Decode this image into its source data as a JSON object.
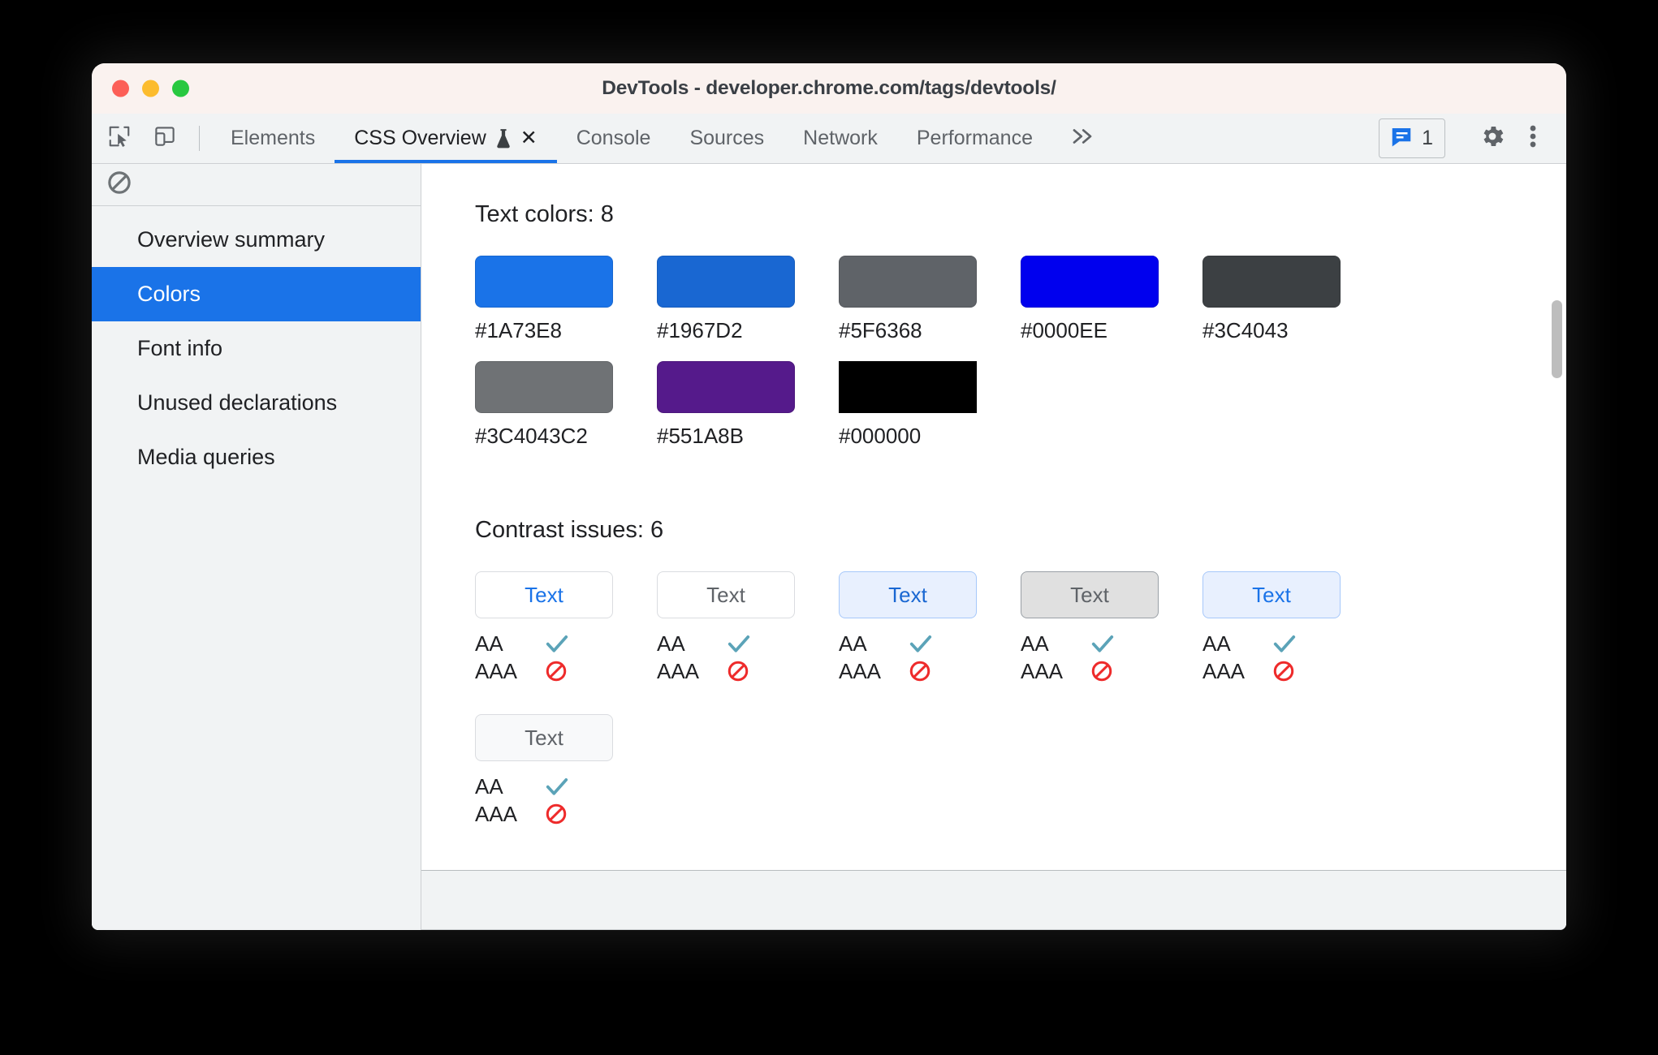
{
  "window": {
    "title": "DevTools - developer.chrome.com/tags/devtools/",
    "traffic_lights": [
      "close",
      "minimize",
      "maximize"
    ]
  },
  "toolbar": {
    "inspect_icon": "inspect-cursor-icon",
    "device_icon": "device-toolbar-icon",
    "tabs": [
      {
        "label": "Elements",
        "active": false
      },
      {
        "label": "CSS Overview",
        "active": true,
        "experiment": true,
        "closable": true
      },
      {
        "label": "Console",
        "active": false
      },
      {
        "label": "Sources",
        "active": false
      },
      {
        "label": "Network",
        "active": false
      },
      {
        "label": "Performance",
        "active": false
      }
    ],
    "more_tabs_icon": "chevron-double-right-icon",
    "issues": {
      "icon": "message-issues-icon",
      "count": "1"
    },
    "settings_icon": "gear-icon",
    "menu_icon": "three-dot-menu-icon"
  },
  "sidebar": {
    "clear_icon": "no-entry-clear-icon",
    "items": [
      {
        "label": "Overview summary",
        "selected": false
      },
      {
        "label": "Colors",
        "selected": true
      },
      {
        "label": "Font info",
        "selected": false
      },
      {
        "label": "Unused declarations",
        "selected": false
      },
      {
        "label": "Media queries",
        "selected": false
      }
    ]
  },
  "main": {
    "text_colors": {
      "title": "Text colors: 8",
      "swatches": [
        {
          "label": "#1A73E8",
          "color": "#1a73e8",
          "sharp": false
        },
        {
          "label": "#1967D2",
          "color": "#1967d2",
          "sharp": false
        },
        {
          "label": "#5F6368",
          "color": "#5f6368",
          "sharp": false
        },
        {
          "label": "#0000EE",
          "color": "#0000ee",
          "sharp": false
        },
        {
          "label": "#3C4043",
          "color": "#3c4043",
          "sharp": false
        },
        {
          "label": "#3C4043C2",
          "color": "#6f7275",
          "sharp": false
        },
        {
          "label": "#551A8B",
          "color": "#551a8b",
          "sharp": false
        },
        {
          "label": "#000000",
          "color": "#000000",
          "sharp": true
        }
      ]
    },
    "contrast_issues": {
      "title": "Contrast issues: 6",
      "sample_text": "Text",
      "aa_label": "AA",
      "aaa_label": "AAA",
      "pass_icon": "check-icon",
      "fail_icon": "no-entry-icon",
      "pass_color": "#5ba3b8",
      "fail_color": "#ee2b2b",
      "cards": [
        {
          "bg": "#ffffff",
          "border": "#dadce0",
          "fg": "#1a73e8",
          "aa": "pass",
          "aaa": "fail"
        },
        {
          "bg": "#ffffff",
          "border": "#dadce0",
          "fg": "#5f6368",
          "aa": "pass",
          "aaa": "fail"
        },
        {
          "bg": "#e8f0fe",
          "border": "#a6c8fa",
          "fg": "#1967d2",
          "aa": "pass",
          "aaa": "fail"
        },
        {
          "bg": "#e0e0e0",
          "border": "#9aa0a6",
          "fg": "#5f6368",
          "aa": "pass",
          "aaa": "fail"
        },
        {
          "bg": "#e8f0fe",
          "border": "#a6c8fa",
          "fg": "#1a73e8",
          "aa": "pass",
          "aaa": "fail"
        },
        {
          "bg": "#f8f9fa",
          "border": "#dadce0",
          "fg": "#5f6368",
          "aa": "pass",
          "aaa": "fail"
        }
      ]
    }
  }
}
